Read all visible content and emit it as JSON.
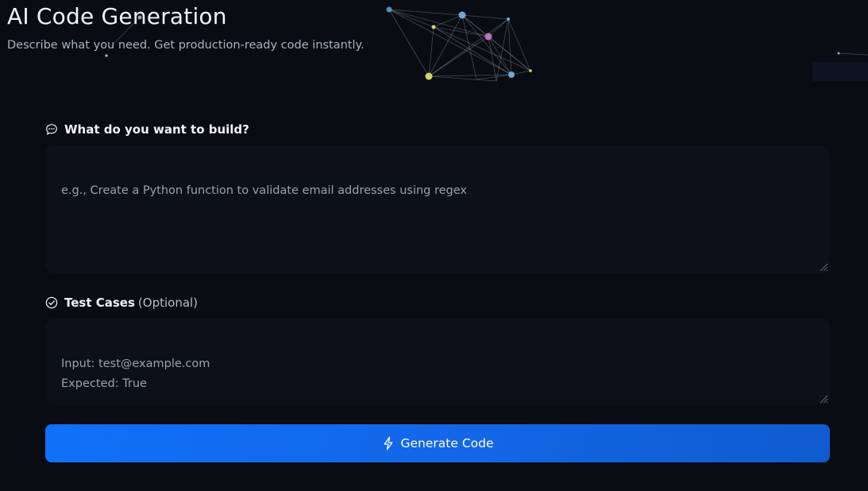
{
  "header": {
    "title": "AI Code Generation",
    "subtitle": "Describe what you need. Get production-ready code instantly."
  },
  "colors": {
    "background": "#090c12",
    "field_background": "#0c1119",
    "button_gradient_start": "#1070f8",
    "button_gradient_end": "#0f5bcf",
    "node_blue": "#6fa8d6",
    "node_yellow": "#d9d46a",
    "node_purple": "#b873c4"
  },
  "prompt_field": {
    "icon": "chat-bubble-icon",
    "label": "What do you want to build?",
    "placeholder": "e.g., Create a Python function to validate email addresses using regex"
  },
  "test_cases_field": {
    "icon": "check-circle-icon",
    "label": "Test Cases",
    "label_suffix": "(Optional)",
    "placeholder": "Input: test@example.com\nExpected: True"
  },
  "generate_button": {
    "icon": "lightning-icon",
    "label": "Generate Code"
  }
}
